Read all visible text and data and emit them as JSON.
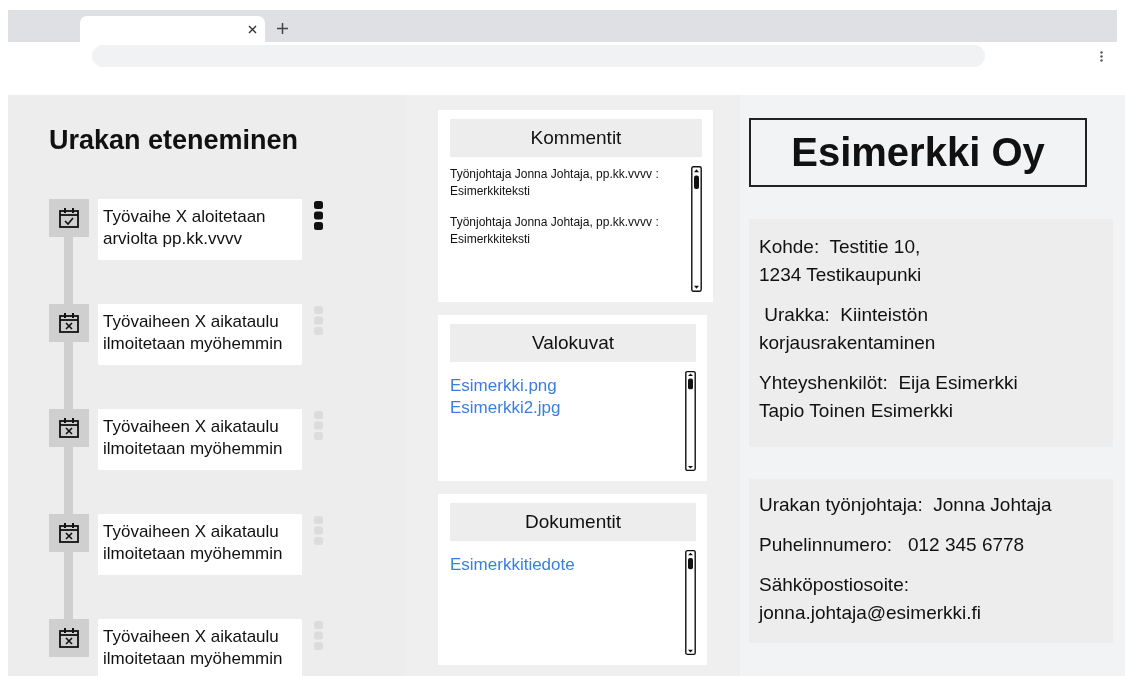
{
  "browser": {
    "tabs": [
      {
        "selected": true
      }
    ]
  },
  "progress": {
    "title": "Urakan eteneminen",
    "steps": [
      {
        "kind": "confirmed",
        "text": "Työvaihe X aloitetaan arviolta pp.kk.vvvv"
      },
      {
        "kind": "pending",
        "text": "Työvaiheen X aikataulu ilmoitetaan myöhemmin"
      },
      {
        "kind": "pending",
        "text": "Työvaiheen X aikataulu ilmoitetaan myöhemmin"
      },
      {
        "kind": "pending",
        "text": "Työvaiheen X aikataulu ilmoitetaan myöhemmin"
      },
      {
        "kind": "pending",
        "text": "Työvaiheen X aikataulu ilmoitetaan myöhemmin"
      }
    ]
  },
  "panels": [
    {
      "kind": "comments",
      "title": "Kommentit",
      "items": [
        "Työnjohtaja Jonna Johtaja, pp.kk.vvvv : Esimerkkiteksti",
        "Työnjohtaja Jonna Johtaja, pp.kk.vvvv : Esimerkkiteksti"
      ]
    },
    {
      "kind": "links",
      "title": "Valokuvat",
      "items": [
        "Esimerkki.png",
        "Esimerkki2.jpg"
      ]
    },
    {
      "kind": "links",
      "title": "Dokumentit",
      "items": [
        "Esimerkkitiedote"
      ]
    }
  ],
  "company": {
    "name": "Esimerkki Oy"
  },
  "info_groups": [
    {
      "fields": [
        {
          "lines": [
            "Kohde:  Testitie 10,",
            "1234 Testikaupunki"
          ]
        },
        {
          "lines": [
            " Urakka:  Kiinteistön",
            "korjausrakentaminen"
          ]
        },
        {
          "lines": [
            "Yhteyshenkilöt:  Eija Esimerkki",
            "Tapio Toinen Esimerkki"
          ]
        }
      ]
    },
    {
      "fields": [
        {
          "lines": [
            "Urakan työnjohtaja:  Jonna Johtaja"
          ]
        },
        {
          "lines": [
            "Puhelinnumero:   012 345 6778"
          ]
        },
        {
          "lines": [
            "Sähköpostiosoite:",
            "jonna.johtaja@esimerkki.fi"
          ]
        }
      ]
    }
  ]
}
